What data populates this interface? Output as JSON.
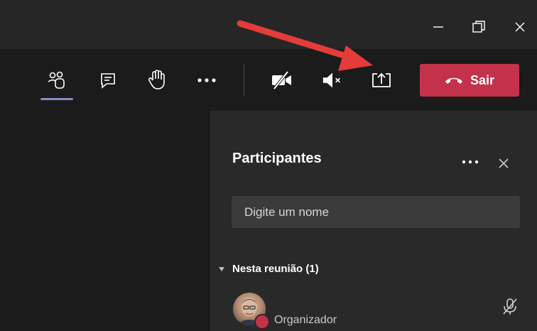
{
  "window": {
    "controls": [
      {
        "name": "minimize-icon",
        "glyph": "minimize"
      },
      {
        "name": "restore-icon",
        "glyph": "restore"
      },
      {
        "name": "close-icon",
        "glyph": "close"
      }
    ]
  },
  "toolbar": {
    "icons": [
      "participants-icon",
      "chat-icon",
      "raise-hand-icon",
      "more-options-icon",
      "camera-off-icon",
      "speaker-mute-icon",
      "share-screen-icon"
    ],
    "leave_label": "Sair"
  },
  "participants_panel": {
    "title": "Participantes",
    "search_placeholder": "Digite um nome",
    "section_label": "Nesta reunião (1)",
    "member_role": "Organizador"
  },
  "colors": {
    "leave_button": "#c4314b",
    "active_tab": "#8b8cc7",
    "annotation_arrow": "#e53b3b"
  }
}
